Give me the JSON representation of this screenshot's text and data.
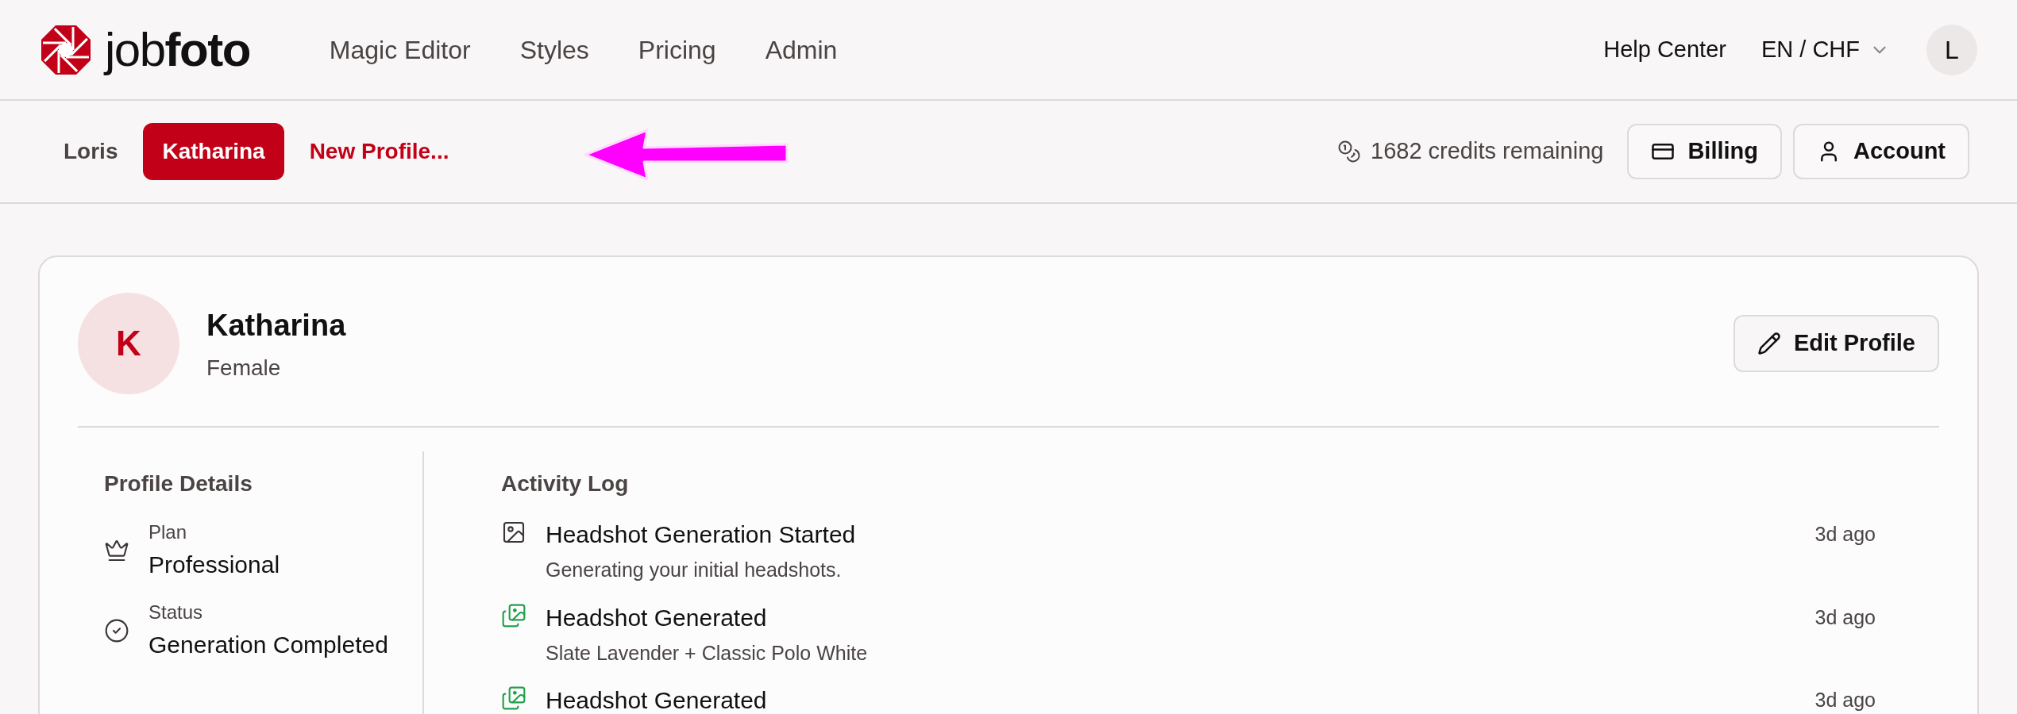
{
  "header": {
    "brand": {
      "light": "job",
      "bold": "foto"
    },
    "nav": [
      "Magic Editor",
      "Styles",
      "Pricing",
      "Admin"
    ],
    "help": "Help Center",
    "locale": "EN / CHF",
    "avatar": "L"
  },
  "profile_bar": {
    "tabs": [
      {
        "label": "Loris",
        "kind": "profile",
        "selected": false
      },
      {
        "label": "Katharina",
        "kind": "profile",
        "selected": true
      },
      {
        "label": "New Profile...",
        "kind": "new"
      }
    ],
    "credits": "1682 credits remaining",
    "buttons": [
      {
        "label": "Billing",
        "kind": "billing"
      },
      {
        "label": "Account",
        "kind": "account"
      }
    ]
  },
  "profile": {
    "initial": "K",
    "name": "Katharina",
    "gender": "Female",
    "edit_button": "Edit Profile",
    "details_title": "Profile Details",
    "details": [
      {
        "kind": "plan",
        "label": "Plan",
        "value": "Professional"
      },
      {
        "kind": "status",
        "label": "Status",
        "value": "Generation Completed"
      }
    ],
    "activity_title": "Activity Log",
    "activity": [
      {
        "kind": "started",
        "title": "Headshot Generation Started",
        "subtitle": "Generating your initial headshots.",
        "time": "3d ago"
      },
      {
        "kind": "generated",
        "title": "Headshot Generated",
        "subtitle": "Slate Lavender + Classic Polo White",
        "time": "3d ago"
      },
      {
        "kind": "generated",
        "title": "Headshot Generated",
        "time": "3d ago"
      }
    ]
  }
}
